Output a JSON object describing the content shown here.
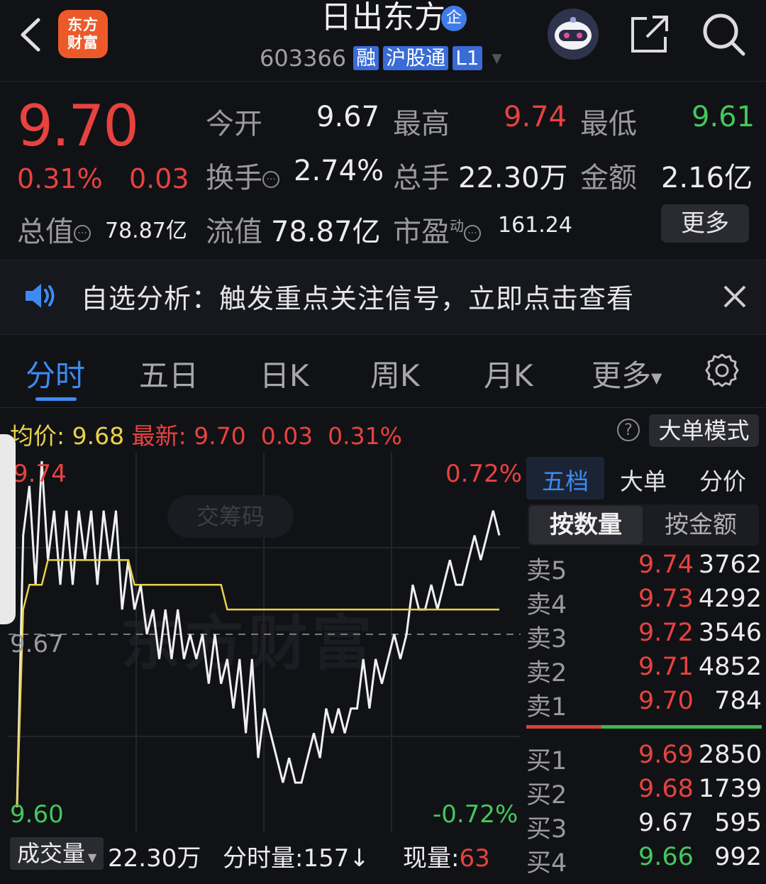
{
  "header": {
    "logo_text_line1": "东方",
    "logo_text_line2": "财富",
    "stock_name": "日出东方",
    "enterprise_badge": "企",
    "code": "603366",
    "tags": [
      "融",
      "沪股通",
      "L1"
    ],
    "icons": [
      "back-chevron-icon",
      "robot-avatar-icon",
      "share-icon",
      "search-icon"
    ]
  },
  "quote": {
    "price": "9.70",
    "change_pct": "0.31%",
    "change_val": "0.03",
    "open_label": "今开",
    "open": "9.67",
    "high_label": "最高",
    "high": "9.74",
    "low_label": "最低",
    "low": "9.61",
    "turnover_label": "换手",
    "turnover": "2.74%",
    "volume_label": "总手",
    "volume": "22.30万",
    "amount_label": "金额",
    "amount": "2.16亿",
    "mktcap_label": "总值",
    "mktcap": "78.87亿",
    "float_label": "流值",
    "float": "78.87亿",
    "pe_label": "市盈",
    "pe_sup": "动",
    "pe": "161.24",
    "more_label": "更多"
  },
  "banner": {
    "text": "自选分析：触发重点关注信号，立即点击查看"
  },
  "tabs": {
    "items": [
      "分时",
      "五日",
      "日K",
      "周K",
      "月K",
      "更多"
    ],
    "active_index": 0
  },
  "avg_row": {
    "avg_label": "均价:",
    "avg_value": "9.68",
    "latest_label": "最新:",
    "latest_value": "9.70",
    "latest_change": "0.03",
    "latest_pct": "0.31%",
    "help": "?",
    "big_order_mode": "大单模式"
  },
  "chart_data": {
    "type": "line",
    "y_top_label": "9.74",
    "y_mid_label": "9.67",
    "y_bottom_label": "9.60",
    "pct_top_label": "0.72%",
    "pct_bottom_label": "-0.72%",
    "ylim": [
      9.6,
      9.74
    ],
    "prev_close": 9.67,
    "watermark": "东方财富",
    "chip_button": "交筹码",
    "series": [
      {
        "values": [
          9.6,
          9.71,
          9.73,
          9.69,
          9.74,
          9.7,
          9.72,
          9.69,
          9.72,
          9.69,
          9.72,
          9.7,
          9.72,
          9.69,
          9.72,
          9.7,
          9.72,
          9.68,
          9.7,
          9.68,
          9.69,
          9.67,
          9.68,
          9.66,
          9.68,
          9.66,
          9.68,
          9.66,
          9.67,
          9.66,
          9.67,
          9.65,
          9.67,
          9.65,
          9.66,
          9.64,
          9.66,
          9.63,
          9.66,
          9.62,
          9.64,
          9.63,
          9.62,
          9.61,
          9.62,
          9.61,
          9.61,
          9.62,
          9.63,
          9.62,
          9.64,
          9.63,
          9.64,
          9.63,
          9.64,
          9.64,
          9.66,
          9.64,
          9.66,
          9.65,
          9.66,
          9.67,
          9.66,
          9.67,
          9.69,
          9.68,
          9.68,
          9.69,
          9.68,
          9.69,
          9.7,
          9.69,
          9.69,
          9.7,
          9.71,
          9.7,
          9.71,
          9.72,
          9.71
        ]
      },
      {
        "values": [
          9.6,
          9.68,
          9.69,
          9.69,
          9.69,
          9.7,
          9.7,
          9.7,
          9.7,
          9.7,
          9.7,
          9.7,
          9.7,
          9.7,
          9.7,
          9.7,
          9.7,
          9.7,
          9.7,
          9.69,
          9.69,
          9.69,
          9.69,
          9.69,
          9.69,
          9.69,
          9.69,
          9.69,
          9.69,
          9.69,
          9.69,
          9.69,
          9.69,
          9.69,
          9.68,
          9.68,
          9.68,
          9.68,
          9.68,
          9.68,
          9.68,
          9.68,
          9.68,
          9.68,
          9.68,
          9.68,
          9.68,
          9.68,
          9.68,
          9.68,
          9.68,
          9.68,
          9.68,
          9.68,
          9.68,
          9.68,
          9.68,
          9.68,
          9.68,
          9.68,
          9.68,
          9.68,
          9.68,
          9.68,
          9.68,
          9.68,
          9.68,
          9.68,
          9.68,
          9.68,
          9.68,
          9.68,
          9.68,
          9.68,
          9.68,
          9.68,
          9.68,
          9.68,
          9.68
        ]
      }
    ]
  },
  "order_book": {
    "tabs": [
      "五档",
      "大单",
      "分价"
    ],
    "active_tab": 0,
    "modes": [
      "按数量",
      "按金额"
    ],
    "asks": [
      {
        "label": "卖5",
        "price": "9.74",
        "vol": "3762",
        "color": "#e8423f"
      },
      {
        "label": "卖4",
        "price": "9.73",
        "vol": "4292",
        "color": "#e8423f"
      },
      {
        "label": "卖3",
        "price": "9.72",
        "vol": "3546",
        "color": "#e8423f"
      },
      {
        "label": "卖2",
        "price": "9.71",
        "vol": "4852",
        "color": "#e8423f"
      },
      {
        "label": "卖1",
        "price": "9.70",
        "vol": "784",
        "color": "#e8423f"
      }
    ],
    "bids": [
      {
        "label": "买1",
        "price": "9.69",
        "vol": "2850",
        "color": "#e8423f"
      },
      {
        "label": "买2",
        "price": "9.68",
        "vol": "1739",
        "color": "#e8423f"
      },
      {
        "label": "买3",
        "price": "9.67",
        "vol": "595",
        "color": "#ececec"
      },
      {
        "label": "买4",
        "price": "9.66",
        "vol": "992",
        "color": "#42c85a"
      }
    ]
  },
  "volume_row": {
    "select_label": "成交量",
    "total": "22.30万",
    "minute_label": "分时量:157",
    "minute_arrow": "↓",
    "now_label": "现量:",
    "now_value": "63"
  },
  "colors": {
    "up": "#e8423f",
    "down": "#42c85a",
    "accent": "#3d8bf2",
    "avg_line": "#e8d24a"
  }
}
